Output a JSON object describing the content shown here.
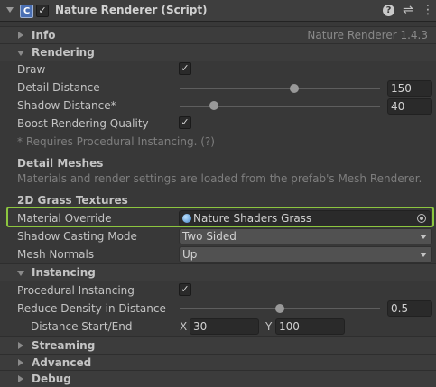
{
  "header": {
    "title": "Nature Renderer (Script)",
    "script_glyph": "C",
    "enabled_mark": "✓",
    "help_glyph": "?",
    "preset_glyph": "⇌",
    "menu_glyph": "⋮"
  },
  "info": {
    "label": "Info",
    "version": "Nature Renderer 1.4.3"
  },
  "rendering": {
    "label": "Rendering",
    "draw_label": "Draw",
    "draw_mark": "✓",
    "detail_distance_label": "Detail Distance",
    "detail_distance_value": "150",
    "detail_distance_slider": 0.57,
    "shadow_distance_label": "Shadow Distance*",
    "shadow_distance_value": "40",
    "shadow_distance_slider": 0.17,
    "boost_label": "Boost Rendering Quality",
    "boost_mark": "✓",
    "note": "* Requires Procedural Instancing. (?)"
  },
  "detail_meshes": {
    "title": "Detail Meshes",
    "description": "Materials and render settings are loaded from the prefab's Mesh Renderer."
  },
  "grass": {
    "title": "2D Grass Textures",
    "material_override_label": "Material Override",
    "material_override_value": "Nature Shaders Grass",
    "shadow_casting_label": "Shadow Casting Mode",
    "shadow_casting_value": "Two Sided",
    "mesh_normals_label": "Mesh Normals",
    "mesh_normals_value": "Up"
  },
  "instancing": {
    "label": "Instancing",
    "procedural_label": "Procedural Instancing",
    "procedural_mark": "✓",
    "reduce_density_label": "Reduce Density in Distance",
    "reduce_density_value": "0.5",
    "reduce_density_slider": 0.5,
    "distance_label": "Distance Start/End",
    "x_label": "X",
    "x_value": "30",
    "y_label": "Y",
    "y_value": "100"
  },
  "sections": {
    "streaming": "Streaming",
    "advanced": "Advanced",
    "debug": "Debug"
  },
  "colors": {
    "background": "#383838",
    "highlight": "#8cc63f",
    "text": "#c4c4c4",
    "muted": "#7e7e7e"
  },
  "icons": {
    "material_icon": "material-sphere-icon",
    "picker_icon": "object-picker-icon"
  }
}
